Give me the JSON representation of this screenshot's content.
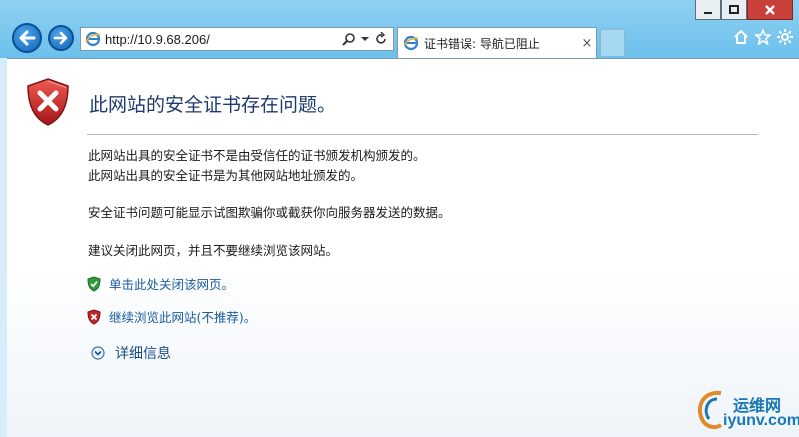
{
  "browser": {
    "address": "http://10.9.68.206/",
    "tab_title": "证书错误: 导航已阻止",
    "tab_close": "×"
  },
  "page": {
    "title": "此网站的安全证书存在问题。",
    "line1": "此网站出具的安全证书不是由受信任的证书颁发机构颁发的。",
    "line2": "此网站出具的安全证书是为其他网站地址颁发的。",
    "line3": "安全证书问题可能显示试图欺骗你或截获你向服务器发送的数据。",
    "line4": "建议关闭此网页，并且不要继续浏览该网站。",
    "close_link": "单击此处关闭该网页。",
    "continue_link": "继续浏览此网站(不推荐)。",
    "details": "详细信息"
  },
  "watermark": {
    "cn": "运维网",
    "en": "iyunv.com"
  },
  "colors": {
    "link": "#1a5ca0",
    "title": "#1f3b6e",
    "error_red": "#c0282a",
    "ok_green": "#2e9a3a"
  }
}
